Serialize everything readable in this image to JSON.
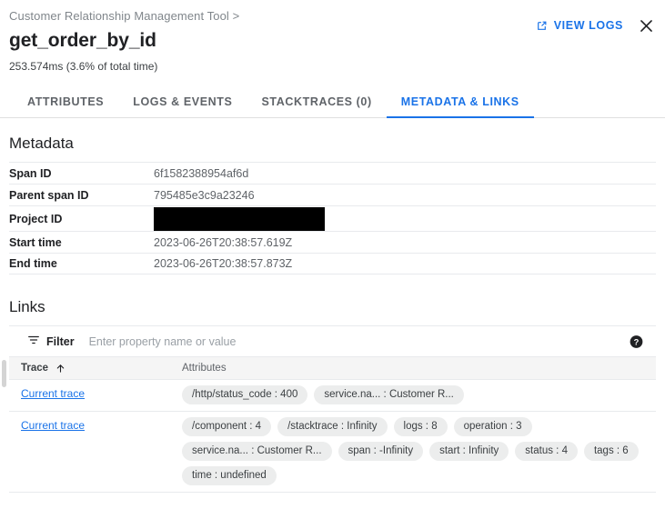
{
  "header": {
    "breadcrumb": "Customer Relationship Management Tool >",
    "title": "get_order_by_id",
    "subtitle": "253.574ms  (3.6% of total time)",
    "view_logs_label": "VIEW LOGS",
    "accent_color": "#1a73e8"
  },
  "tabs": [
    {
      "label": "ATTRIBUTES",
      "active": false
    },
    {
      "label": "LOGS & EVENTS",
      "active": false
    },
    {
      "label": "STACKTRACES (0)",
      "active": false
    },
    {
      "label": "METADATA & LINKS",
      "active": true
    }
  ],
  "metadata": {
    "section_title": "Metadata",
    "rows": [
      {
        "label": "Span ID",
        "value": "6f1582388954af6d",
        "redacted": false
      },
      {
        "label": "Parent span ID",
        "value": "795485e3c9a23246",
        "redacted": false
      },
      {
        "label": "Project ID",
        "value": "",
        "redacted": true
      },
      {
        "label": "Start time",
        "value": "2023-06-26T20:38:57.619Z",
        "redacted": false
      },
      {
        "label": "End time",
        "value": "2023-06-26T20:38:57.873Z",
        "redacted": false
      }
    ]
  },
  "links": {
    "section_title": "Links",
    "filter_label": "Filter",
    "filter_placeholder": "Enter property name or value",
    "columns": {
      "trace": "Trace",
      "attributes": "Attributes"
    },
    "sort": {
      "column": "Trace",
      "direction": "ascending"
    },
    "rows": [
      {
        "trace_label": "Current trace",
        "chips": [
          "/http/status_code : 400",
          "service.na... : Customer R..."
        ]
      },
      {
        "trace_label": "Current trace",
        "chips": [
          "/component : 4",
          "/stacktrace : Infinity",
          "logs : 8",
          "operation : 3",
          "service.na... : Customer R...",
          "span : -Infinity",
          "start : Infinity",
          "status : 4",
          "tags : 6",
          "time : undefined"
        ]
      }
    ]
  }
}
